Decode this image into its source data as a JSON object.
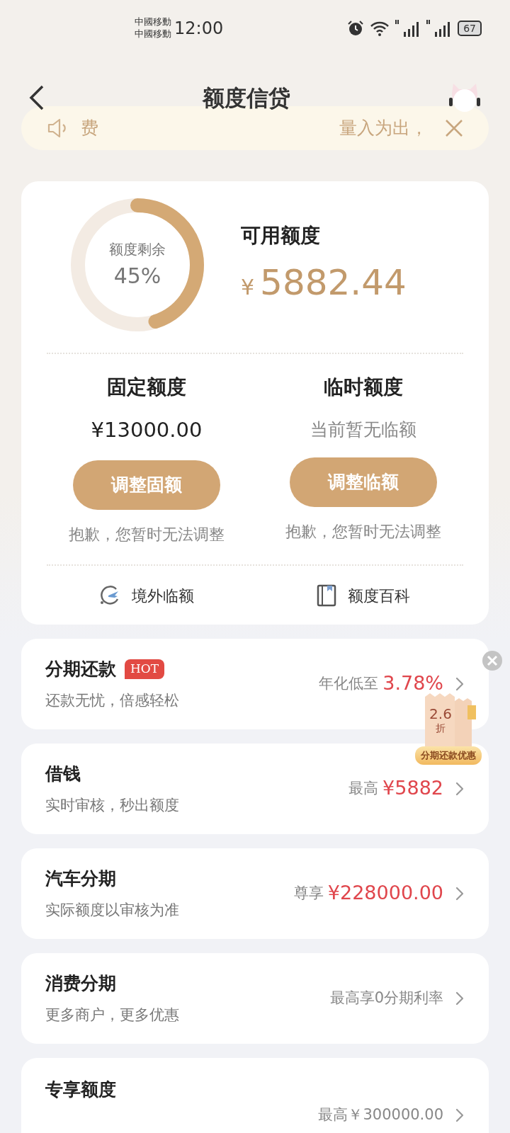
{
  "status_bar": {
    "carriers": [
      "中國移動",
      "中國移動"
    ],
    "time": "12:00",
    "battery": "67"
  },
  "header": {
    "title": "额度信贷"
  },
  "notice": {
    "left": "费",
    "right": "量入为出，"
  },
  "quota": {
    "ring_label": "额度剩余",
    "ring_percent": "45%",
    "level": 0.45,
    "available_label": "可用额度",
    "currency": "¥",
    "available_amount": "5882.44"
  },
  "columns": [
    {
      "title": "固定额度",
      "value": "¥13000.00",
      "kind": "amount",
      "button": "调整固额",
      "note": "抱歉，您暂时无法调整"
    },
    {
      "title": "临时额度",
      "value": "当前暂无临额",
      "kind": "hint",
      "button": "调整临额",
      "note": "抱歉，您暂时无法调整"
    }
  ],
  "links": [
    {
      "label": "境外临额",
      "kind": "plane"
    },
    {
      "label": "额度百科",
      "kind": "book"
    }
  ],
  "products": [
    {
      "title": "分期还款",
      "badge": "HOT",
      "subtitle": "还款无忧，倍感轻松",
      "prefix": "年化低至",
      "highlight": "3.78%"
    },
    {
      "title": "借钱",
      "subtitle": "实时审核，秒出额度",
      "prefix": "最高",
      "highlight": "¥5882"
    },
    {
      "title": "汽车分期",
      "subtitle": "实际额度以审核为准",
      "prefix": "尊享",
      "highlight": "¥228000.00"
    },
    {
      "title": "消费分期",
      "subtitle": "更多商户，更多优惠",
      "prefix": "最高享0分期利率"
    },
    {
      "title": "专享额度",
      "prefix": "最高￥300000.00"
    }
  ],
  "promo": {
    "discount": "2.6",
    "unit": "折",
    "label": "分期还款优惠"
  }
}
